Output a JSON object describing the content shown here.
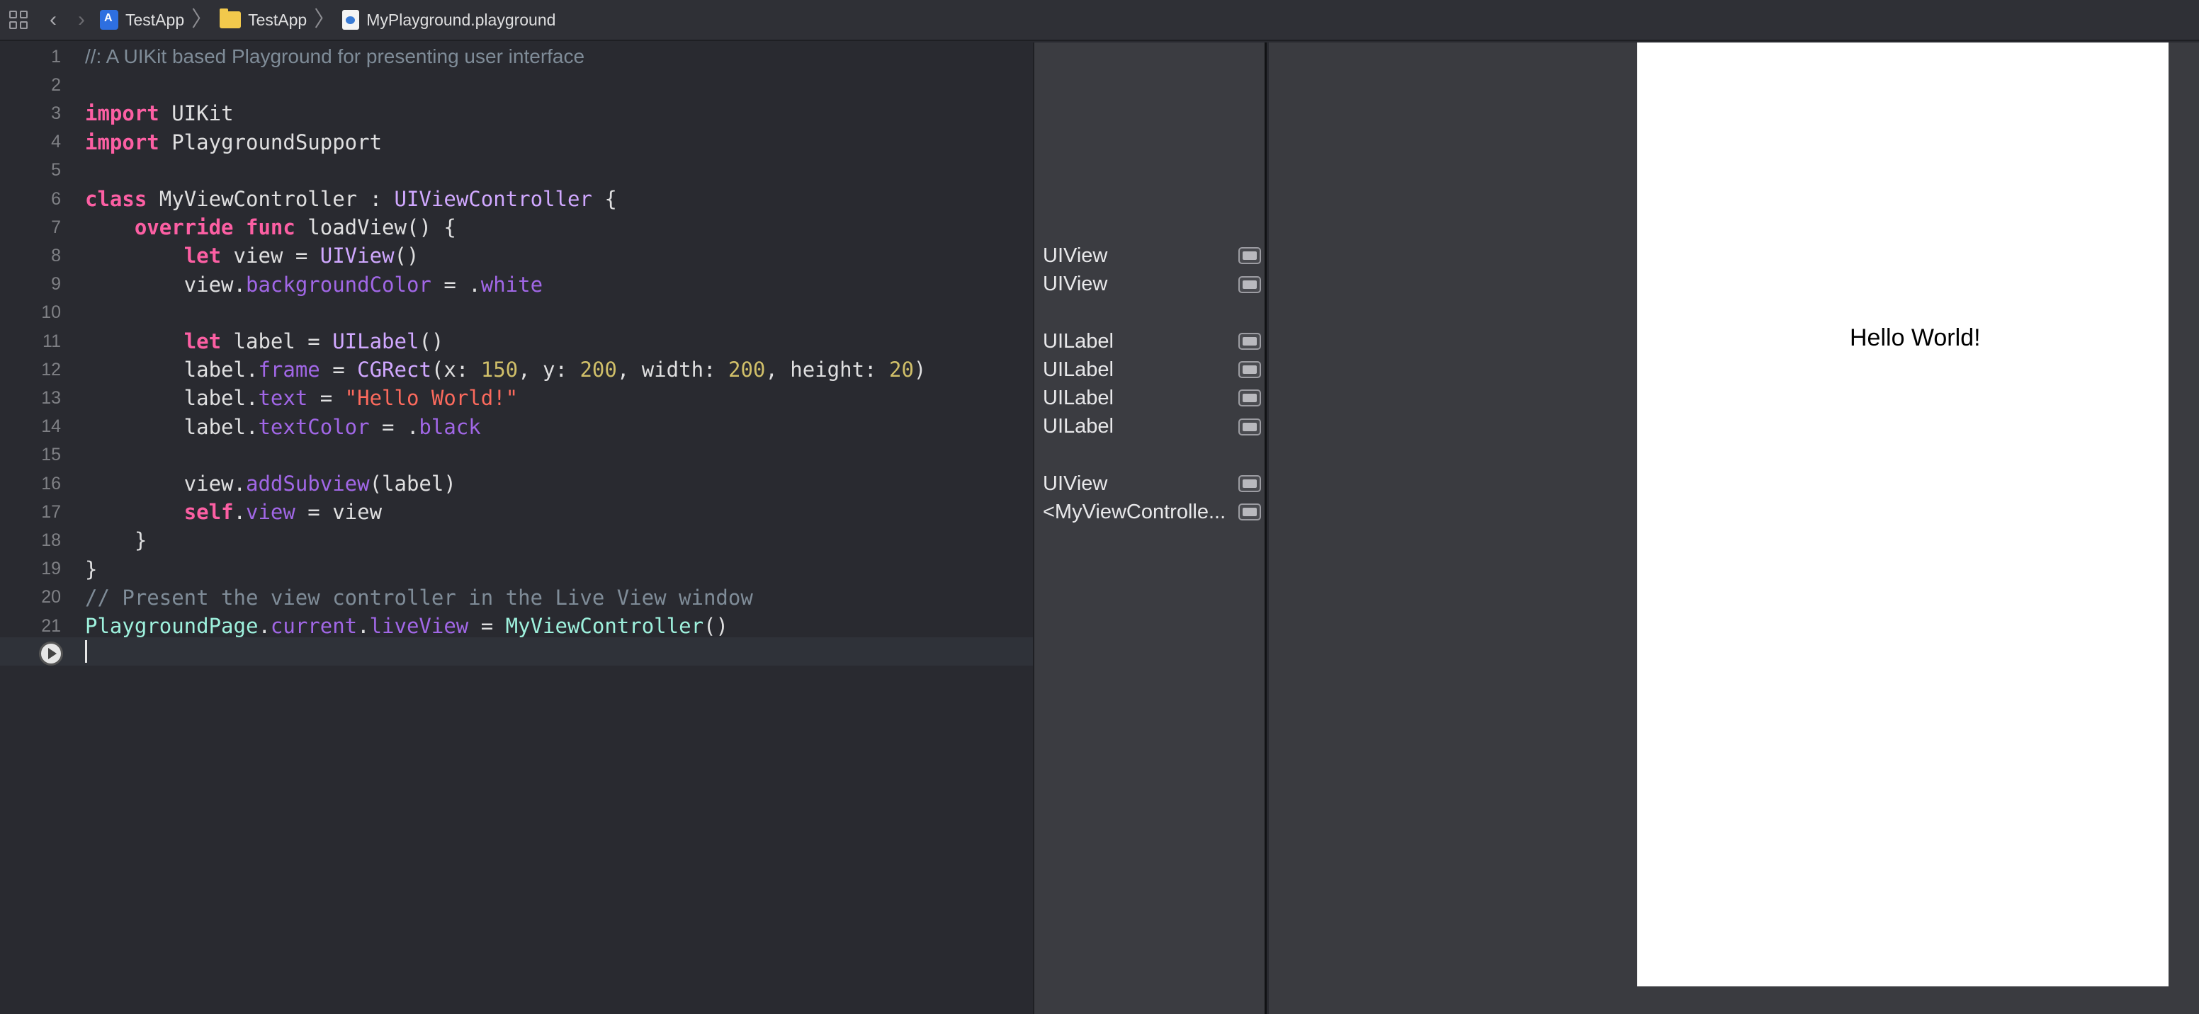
{
  "jumpbar": {
    "breadcrumbs": [
      "TestApp",
      "TestApp",
      "MyPlayground.playground"
    ]
  },
  "editor": {
    "line_numbers": [
      "1",
      "2",
      "3",
      "4",
      "5",
      "6",
      "7",
      "8",
      "9",
      "10",
      "11",
      "12",
      "13",
      "14",
      "15",
      "16",
      "17",
      "18",
      "19",
      "20",
      "21"
    ],
    "lines": [
      {
        "segments": [
          {
            "t": "//: A UIKit based Playground for presenting user interface",
            "c": "doc"
          }
        ]
      },
      {
        "segments": []
      },
      {
        "segments": [
          {
            "t": "import",
            "c": "kw"
          },
          {
            "t": " UIKit",
            "c": ""
          }
        ]
      },
      {
        "segments": [
          {
            "t": "import",
            "c": "kw"
          },
          {
            "t": " PlaygroundSupport",
            "c": ""
          }
        ]
      },
      {
        "segments": []
      },
      {
        "segments": [
          {
            "t": "class",
            "c": "kw"
          },
          {
            "t": " MyViewController : ",
            "c": ""
          },
          {
            "t": "UIViewController",
            "c": "ty"
          },
          {
            "t": " {",
            "c": ""
          }
        ]
      },
      {
        "segments": [
          {
            "t": "    ",
            "c": ""
          },
          {
            "t": "override",
            "c": "kw"
          },
          {
            "t": " ",
            "c": ""
          },
          {
            "t": "func",
            "c": "kw"
          },
          {
            "t": " loadView() {",
            "c": ""
          }
        ]
      },
      {
        "segments": [
          {
            "t": "        ",
            "c": ""
          },
          {
            "t": "let",
            "c": "kw"
          },
          {
            "t": " view = ",
            "c": ""
          },
          {
            "t": "UIView",
            "c": "ty"
          },
          {
            "t": "()",
            "c": ""
          }
        ]
      },
      {
        "segments": [
          {
            "t": "        view.",
            "c": ""
          },
          {
            "t": "backgroundColor",
            "c": "pr"
          },
          {
            "t": " = .",
            "c": ""
          },
          {
            "t": "white",
            "c": "pr"
          }
        ]
      },
      {
        "segments": []
      },
      {
        "segments": [
          {
            "t": "        ",
            "c": ""
          },
          {
            "t": "let",
            "c": "kw"
          },
          {
            "t": " label = ",
            "c": ""
          },
          {
            "t": "UILabel",
            "c": "ty"
          },
          {
            "t": "()",
            "c": ""
          }
        ]
      },
      {
        "segments": [
          {
            "t": "        label.",
            "c": ""
          },
          {
            "t": "frame",
            "c": "pr"
          },
          {
            "t": " = ",
            "c": ""
          },
          {
            "t": "CGRect",
            "c": "ty"
          },
          {
            "t": "(x: ",
            "c": ""
          },
          {
            "t": "150",
            "c": "num"
          },
          {
            "t": ", y: ",
            "c": ""
          },
          {
            "t": "200",
            "c": "num"
          },
          {
            "t": ", width: ",
            "c": ""
          },
          {
            "t": "200",
            "c": "num"
          },
          {
            "t": ", height: ",
            "c": ""
          },
          {
            "t": "20",
            "c": "num"
          },
          {
            "t": ")",
            "c": ""
          }
        ]
      },
      {
        "segments": [
          {
            "t": "        label.",
            "c": ""
          },
          {
            "t": "text",
            "c": "pr"
          },
          {
            "t": " = ",
            "c": ""
          },
          {
            "t": "\"Hello World!\"",
            "c": "str"
          }
        ]
      },
      {
        "segments": [
          {
            "t": "        label.",
            "c": ""
          },
          {
            "t": "textColor",
            "c": "pr"
          },
          {
            "t": " = .",
            "c": ""
          },
          {
            "t": "black",
            "c": "pr"
          }
        ]
      },
      {
        "segments": []
      },
      {
        "segments": [
          {
            "t": "        view.",
            "c": ""
          },
          {
            "t": "addSubview",
            "c": "pr"
          },
          {
            "t": "(label)",
            "c": ""
          }
        ]
      },
      {
        "segments": [
          {
            "t": "        ",
            "c": ""
          },
          {
            "t": "self",
            "c": "kw"
          },
          {
            "t": ".",
            "c": ""
          },
          {
            "t": "view",
            "c": "pr"
          },
          {
            "t": " = view",
            "c": ""
          }
        ]
      },
      {
        "segments": [
          {
            "t": "    }",
            "c": ""
          }
        ]
      },
      {
        "segments": [
          {
            "t": "}",
            "c": ""
          }
        ]
      },
      {
        "segments": [
          {
            "t": "// Present the view controller in the Live View window",
            "c": "cm"
          }
        ]
      },
      {
        "segments": [
          {
            "t": "PlaygroundPage",
            "c": "cl"
          },
          {
            "t": ".",
            "c": ""
          },
          {
            "t": "current",
            "c": "pr"
          },
          {
            "t": ".",
            "c": ""
          },
          {
            "t": "liveView",
            "c": "pr"
          },
          {
            "t": " = ",
            "c": ""
          },
          {
            "t": "MyViewController",
            "c": "cl"
          },
          {
            "t": "()",
            "c": ""
          }
        ]
      }
    ]
  },
  "results": [
    {
      "line": 8,
      "label": "UIView"
    },
    {
      "line": 9,
      "label": "UIView"
    },
    {
      "line": 11,
      "label": "UILabel"
    },
    {
      "line": 12,
      "label": "UILabel"
    },
    {
      "line": 13,
      "label": "UILabel"
    },
    {
      "line": 14,
      "label": "UILabel"
    },
    {
      "line": 16,
      "label": "UIView"
    },
    {
      "line": 17,
      "label": "<MyViewControlle..."
    }
  ],
  "liveview": {
    "label_text": "Hello World!"
  },
  "colors": {
    "keyword": "#fc5fa3",
    "type": "#d0a8ff",
    "class": "#9ef1dd",
    "property": "#a167e6",
    "number": "#d0bf69",
    "string": "#fc6a5d",
    "comment": "#7f8c98"
  }
}
